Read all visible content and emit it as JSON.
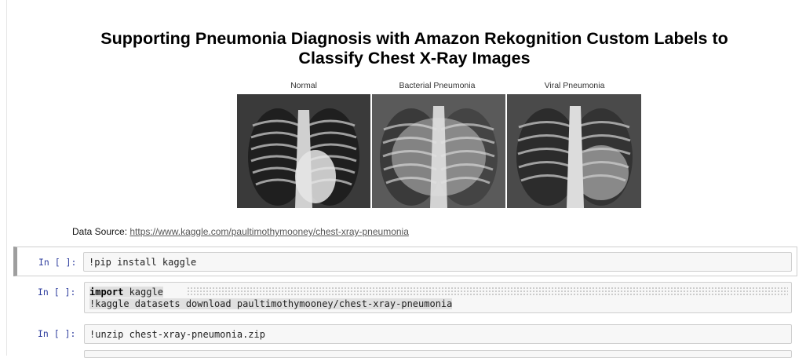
{
  "notebook": {
    "title_line1": "Supporting Pneumonia Diagnosis with Amazon Rekognition Custom Labels to",
    "title_line2": "Classify Chest X-Ray Images",
    "figure_labels": [
      "Normal",
      "Bacterial Pneumonia",
      "Viral Pneumonia"
    ],
    "source_label": "Data Source: ",
    "source_url": "https://www.kaggle.com/paultimothymooney/chest-xray-pneumonia"
  },
  "cells": [
    {
      "prompt": "In [ ]:",
      "lines": [
        "!pip install kaggle"
      ]
    },
    {
      "prompt": "In [ ]:",
      "keyword": "import",
      "line1_rest": " kaggle",
      "line2": "!kaggle datasets download paultimothymooney/chest-xray-pneumonia"
    },
    {
      "prompt": "In [ ]:",
      "lines": [
        "!unzip chest-xray-pneumonia.zip"
      ]
    }
  ],
  "colors": {
    "prompt": "#303f9f",
    "link": "#555555",
    "cell_bg": "#f7f7f7"
  }
}
